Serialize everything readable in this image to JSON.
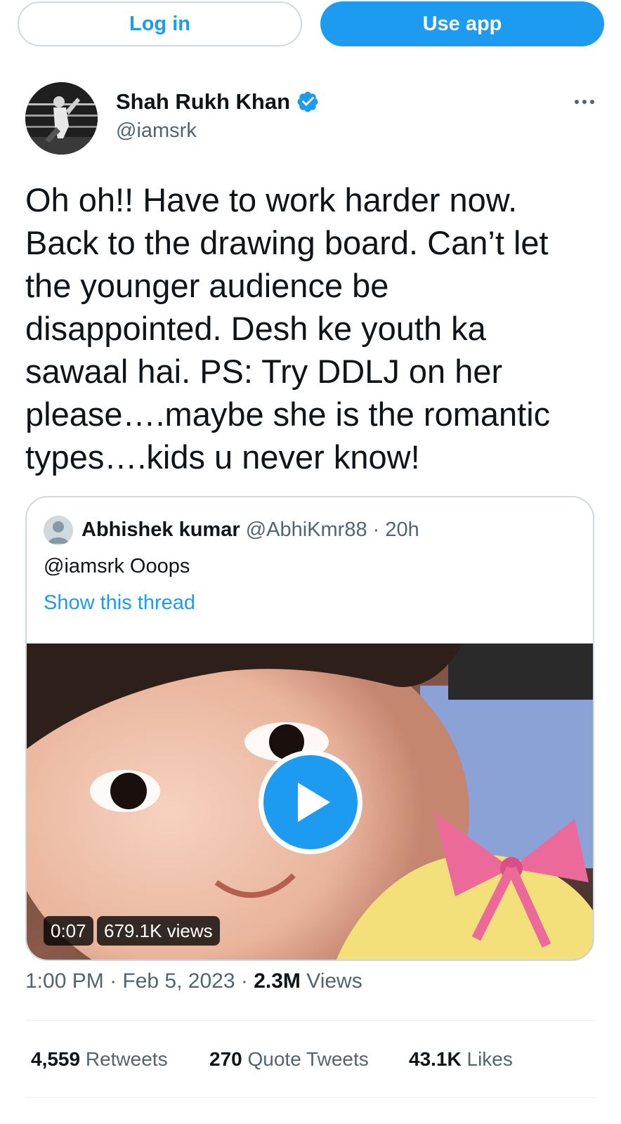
{
  "topbar": {
    "login_label": "Log in",
    "app_label": "Use app"
  },
  "author": {
    "name": "Shah Rukh Khan",
    "handle": "@iamsrk",
    "verified_icon": "verified-badge-icon",
    "avatar_icon": "profile-photo"
  },
  "tweet": {
    "text": "Oh oh!! Have to work harder now.\nBack to the drawing board. Can’t let\nthe younger audience be\ndisappointed. Desh ke youth ka\nsawaal hai. PS: Try DDLJ on her\nplease….maybe she is the romantic\ntypes….kids u never know!"
  },
  "quote": {
    "name": "Abhishek kumar",
    "handle": "@AbhiKmr88",
    "separator": " · ",
    "time": "20h",
    "text": "@iamsrk Ooops",
    "thread_link": "Show this thread",
    "video": {
      "duration": "0:07",
      "views": "679.1K views",
      "play_icon": "play-icon"
    }
  },
  "meta": {
    "time": "1:00 PM",
    "sep1": " · ",
    "date": "Feb 5, 2023",
    "sep2": " · ",
    "views_count": "2.3M",
    "views_label": " Views"
  },
  "stats": {
    "retweets_count": "4,559",
    "retweets_label": " Retweets",
    "quotes_count": "270",
    "quotes_label": " Quote Tweets",
    "likes_count": "43.1K",
    "likes_label": " Likes"
  },
  "colors": {
    "accent": "#1d9bf0",
    "text": "#0f1419",
    "secondary": "#536471",
    "border": "#cfd9de"
  }
}
